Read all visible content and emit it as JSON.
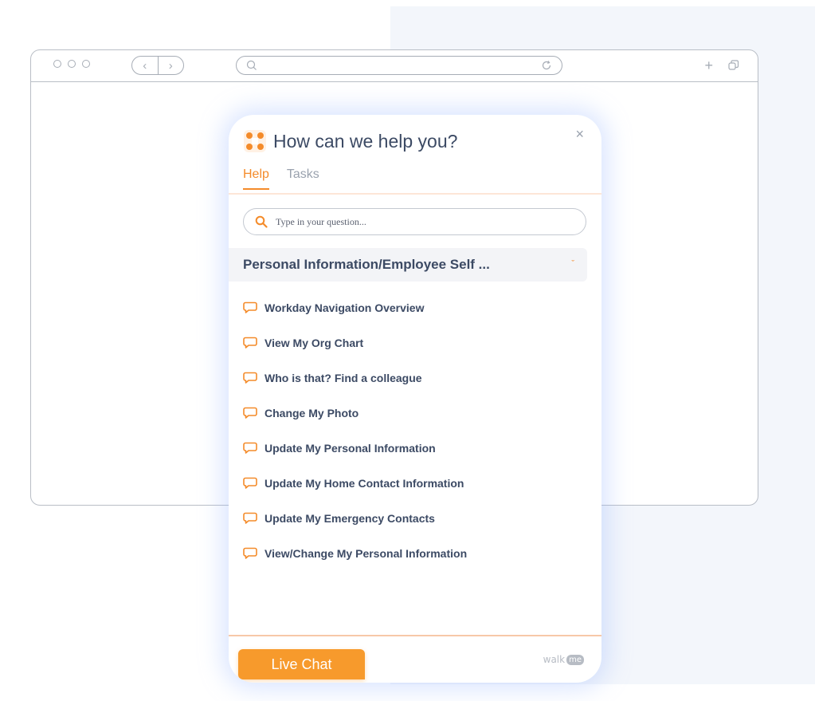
{
  "browser": {
    "icons": [
      "nav-back-icon",
      "nav-forward-icon",
      "search-icon",
      "reload-icon",
      "new-tab-icon",
      "window-restore-icon"
    ]
  },
  "widget": {
    "title": "How can we help you?",
    "close_label": "×",
    "tabs": [
      {
        "label": "Help",
        "active": true
      },
      {
        "label": "Tasks",
        "active": false
      }
    ],
    "search": {
      "placeholder": "Type in your question..."
    },
    "section": {
      "title": "Personal Information/Employee Self ...",
      "chevron": "ˇ"
    },
    "items": [
      {
        "label": "Workday Navigation Overview"
      },
      {
        "label": "View My Org Chart"
      },
      {
        "label": "Who is that? Find a colleague"
      },
      {
        "label": "Change My Photo"
      },
      {
        "label": "Update My Personal Information"
      },
      {
        "label": "Update My Home Contact Information"
      },
      {
        "label": "Update My Emergency Contacts"
      },
      {
        "label": "View/Change My Personal Information"
      }
    ],
    "footer": {
      "live_chat_label": "Live Chat",
      "brand_walk": "walk",
      "brand_me": "me"
    }
  },
  "colors": {
    "accent": "#f48b2a",
    "button": "#f79a2c",
    "text": "#3c4a64",
    "muted": "#9aa2ae"
  }
}
